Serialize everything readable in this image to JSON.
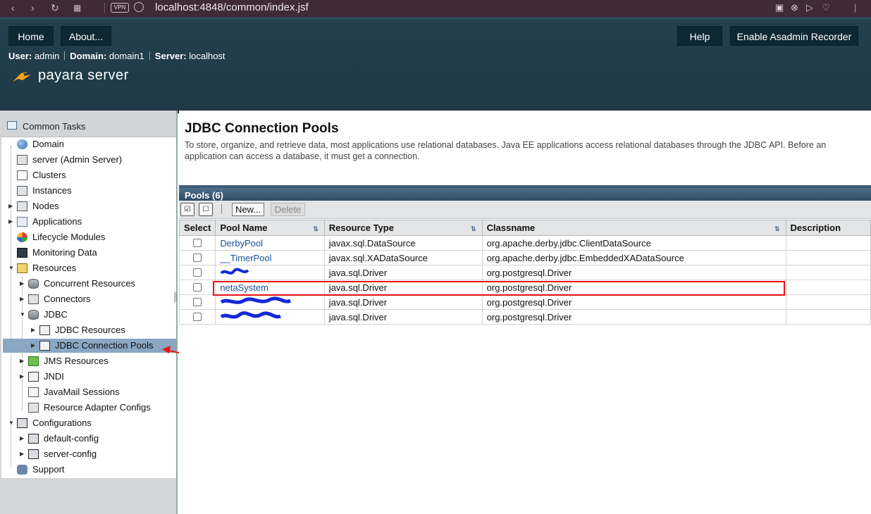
{
  "browser": {
    "url": "localhost:4848/common/index.jsf",
    "vpn_label": "VPN"
  },
  "header": {
    "home_label": "Home",
    "about_label": "About...",
    "help_label": "Help",
    "recorder_label": "Enable Asadmin Recorder",
    "user_key": "User:",
    "user_value": "admin",
    "domain_key": "Domain:",
    "domain_value": "domain1",
    "server_key": "Server:",
    "server_value": "localhost",
    "logo_text": "payara server"
  },
  "sidebar": {
    "title": "Common Tasks",
    "items": [
      {
        "label": "Domain",
        "icon": "globe-icon"
      },
      {
        "label": "server (Admin Server)",
        "icon": "server-icon"
      },
      {
        "label": "Clusters",
        "icon": "cluster-icon"
      },
      {
        "label": "Instances",
        "icon": "instances-icon"
      },
      {
        "label": "Nodes",
        "icon": "nodes-icon"
      },
      {
        "label": "Applications",
        "icon": "applications-icon"
      },
      {
        "label": "Lifecycle Modules",
        "icon": "lifecycle-icon"
      },
      {
        "label": "Monitoring Data",
        "icon": "monitor-icon"
      },
      {
        "label": "Resources",
        "icon": "resources-icon"
      },
      {
        "label": "Concurrent Resources",
        "icon": "database-icon"
      },
      {
        "label": "Connectors",
        "icon": "connectors-icon"
      },
      {
        "label": "JDBC",
        "icon": "database-icon"
      },
      {
        "label": "JDBC Resources",
        "icon": "folder-icon"
      },
      {
        "label": "JDBC Connection Pools",
        "icon": "folder-icon"
      },
      {
        "label": "JMS Resources",
        "icon": "jms-icon"
      },
      {
        "label": "JNDI",
        "icon": "jndi-icon"
      },
      {
        "label": "JavaMail Sessions",
        "icon": "mail-icon"
      },
      {
        "label": "Resource Adapter Configs",
        "icon": "adapter-icon"
      },
      {
        "label": "Configurations",
        "icon": "config-icon"
      },
      {
        "label": "default-config",
        "icon": "config-icon"
      },
      {
        "label": "server-config",
        "icon": "config-icon"
      },
      {
        "label": "Support",
        "icon": "support-icon"
      }
    ]
  },
  "main": {
    "title": "JDBC Connection Pools",
    "help_text": "To store, organize, and retrieve data, most applications use relational databases. Java EE applications access relational databases through the JDBC API. Before an application can access a database, it must get a connection.",
    "table_title": "Pools (6)",
    "new_label": "New...",
    "delete_label": "Delete",
    "columns": {
      "select": "Select",
      "pool_name": "Pool Name",
      "resource_type": "Resource Type",
      "classname": "Classname",
      "description": "Description"
    },
    "rows": [
      {
        "pool_name": "DerbyPool",
        "resource_type": "javax.sql.DataSource",
        "classname": "org.apache.derby.jdbc.ClientDataSource",
        "description": ""
      },
      {
        "pool_name": "__TimerPool",
        "resource_type": "javax.sql.XADataSource",
        "classname": "org.apache.derby.jdbc.EmbeddedXADataSource",
        "description": ""
      },
      {
        "pool_name": "",
        "resource_type": "java.sql.Driver",
        "classname": "org.postgresql.Driver",
        "description": ""
      },
      {
        "pool_name": "netaSystem",
        "resource_type": "java.sql.Driver",
        "classname": "org.postgresql.Driver",
        "description": ""
      },
      {
        "pool_name": "",
        "resource_type": "java.sql.Driver",
        "classname": "org.postgresql.Driver",
        "description": ""
      },
      {
        "pool_name": "",
        "resource_type": "java.sql.Driver",
        "classname": "org.postgresql.Driver",
        "description": ""
      }
    ]
  }
}
